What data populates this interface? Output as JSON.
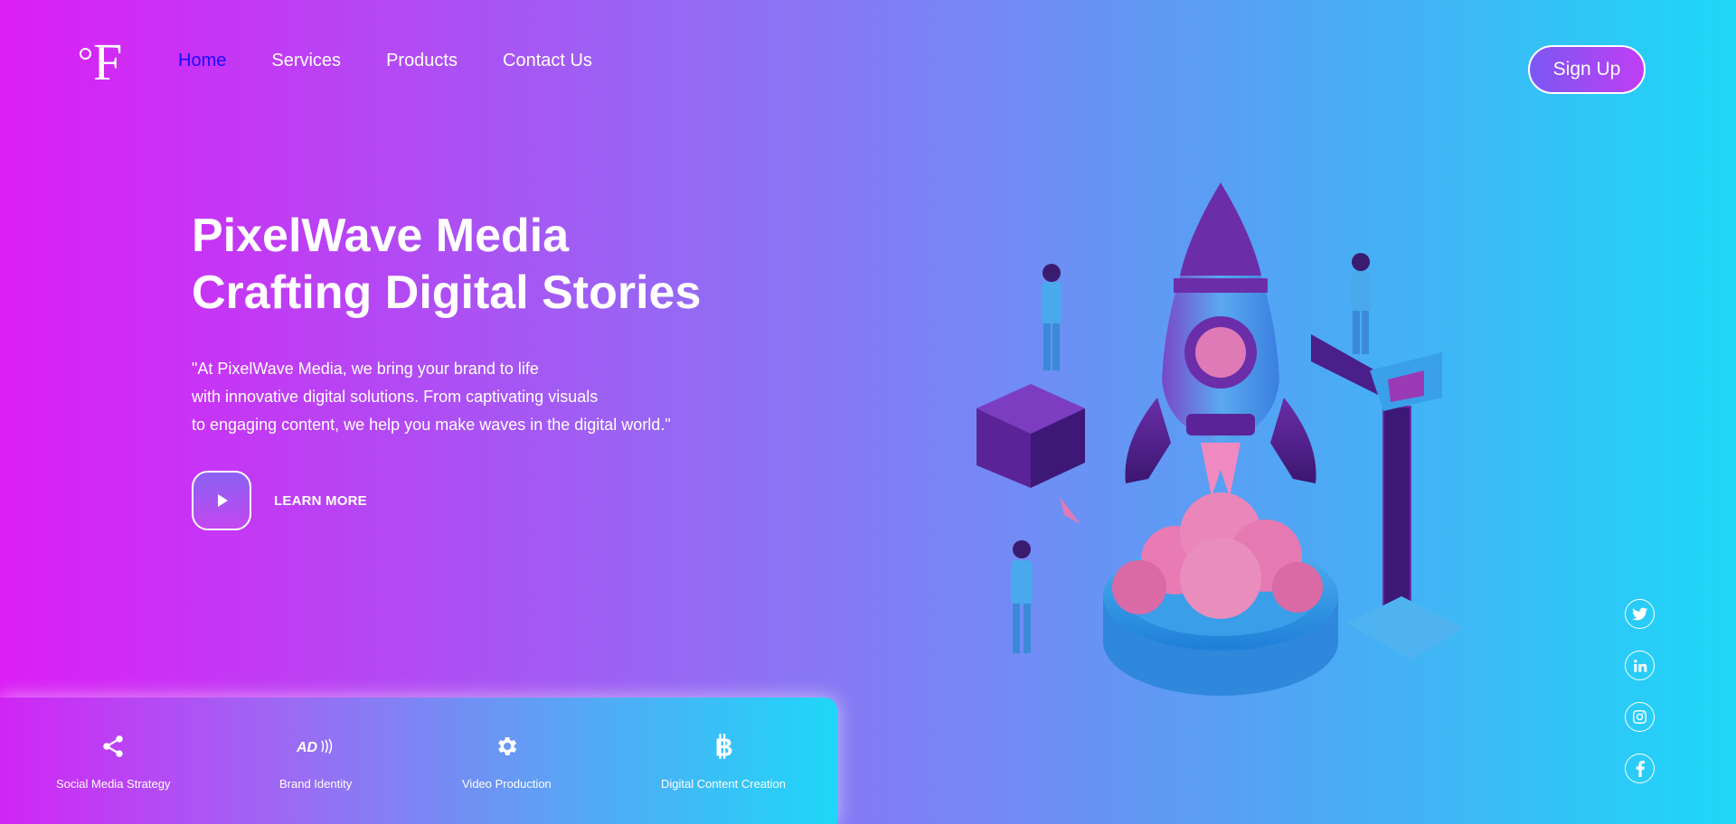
{
  "brand": {
    "logo_letter": "F"
  },
  "nav": {
    "items": [
      {
        "label": "Home",
        "active": true
      },
      {
        "label": "Services",
        "active": false
      },
      {
        "label": "Products",
        "active": false
      },
      {
        "label": "Contact Us",
        "active": false
      }
    ],
    "signup_label": "Sign Up"
  },
  "hero": {
    "title_line1": "PixelWave Media",
    "title_line2": "Crafting Digital Stories",
    "text_line1": "\"At PixelWave Media, we bring your brand to life",
    "text_line2": "with innovative digital solutions. From captivating visuals",
    "text_line3": "to engaging content, we help you make waves in the digital world.\"",
    "cta_label": "LEARN MORE"
  },
  "services": [
    {
      "label": "Social Media Strategy",
      "icon": "share-icon"
    },
    {
      "label": "Brand Identity",
      "icon": "audio-description-icon"
    },
    {
      "label": "Video Production",
      "icon": "gear-icon"
    },
    {
      "label": "Digital Content Creation",
      "icon": "bitcoin-icon"
    }
  ],
  "social": [
    "twitter-icon",
    "linkedin-icon",
    "instagram-icon",
    "facebook-icon"
  ],
  "illustration": {
    "subject": "rocket-launch-illustration"
  },
  "colors": {
    "active_nav": "#1a0cff",
    "gradient_start": "#dc1ef6",
    "gradient_end": "#1ed7f8"
  }
}
